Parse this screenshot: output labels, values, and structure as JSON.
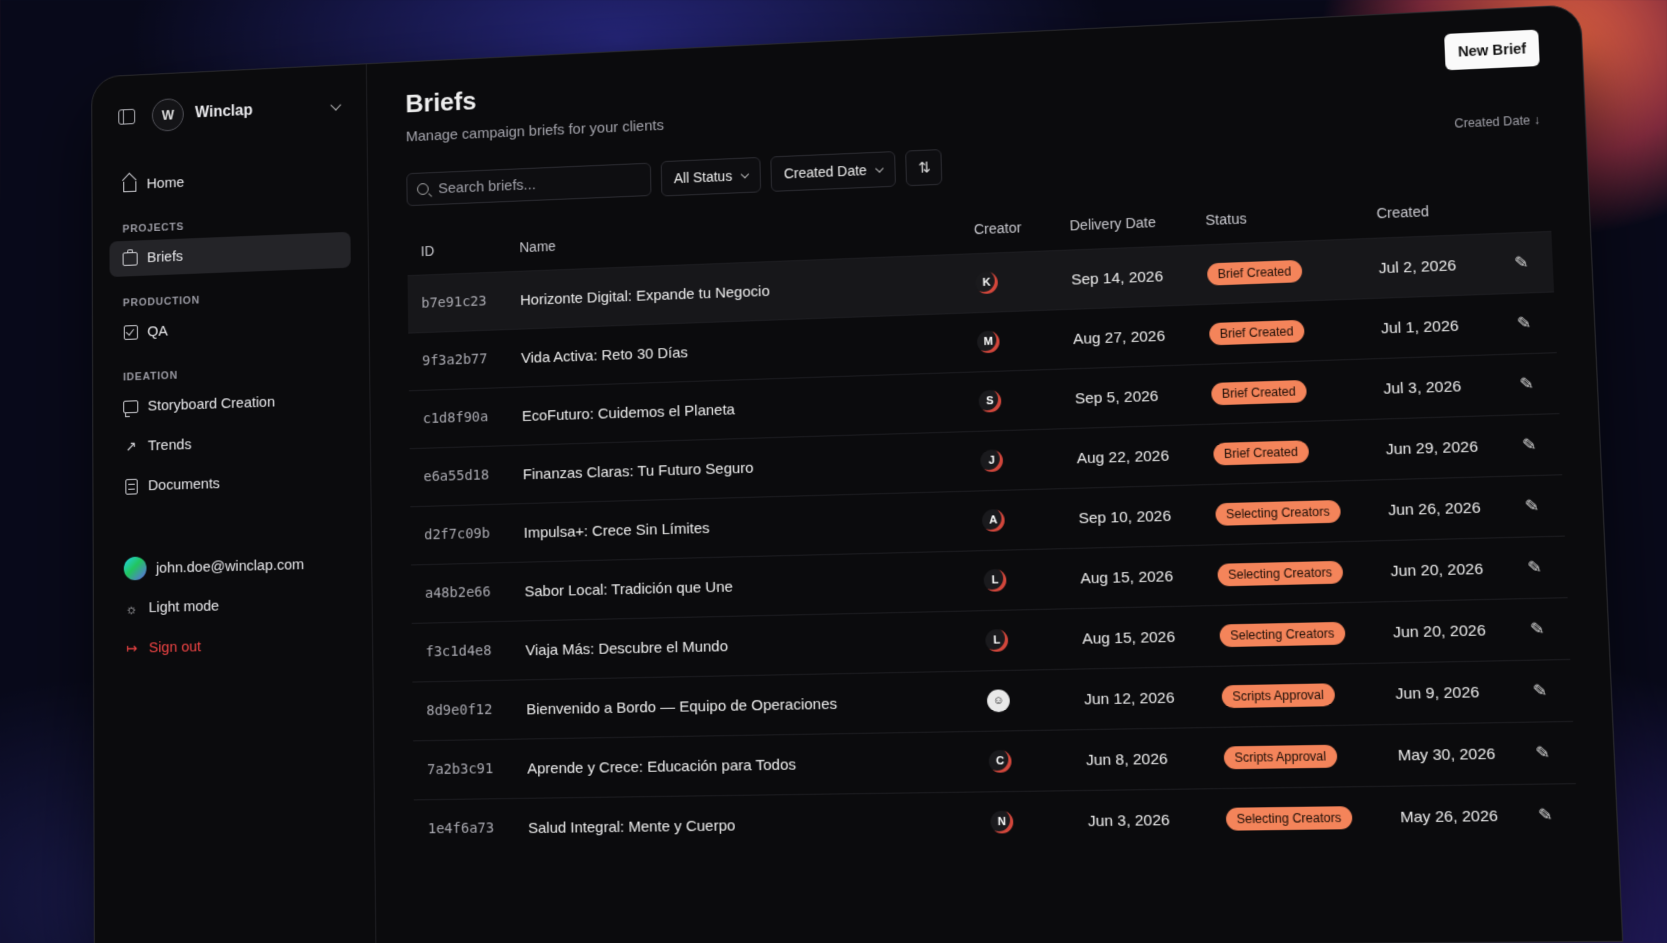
{
  "sidebar": {
    "workspace_name": "Winclap",
    "logo_text": "W",
    "home": "Home",
    "sections": {
      "projects": "PROJECTS",
      "production": "PRODUCTION",
      "ideation": "IDEATION"
    },
    "items": {
      "briefs": "Briefs",
      "qa": "QA",
      "storyboard": "Storyboard Creation",
      "trends": "Trends",
      "documents": "Documents"
    },
    "user_email": "john.doe@winclap.com",
    "light_mode": "Light mode",
    "sign_out": "Sign out"
  },
  "main": {
    "title": "Briefs",
    "subtitle": "Manage campaign briefs for your clients",
    "new_brief": "New Brief",
    "sort_hint": "Created Date ↓",
    "search_placeholder": "Search briefs...",
    "status_filter": "All Status",
    "date_filter": "Created Date",
    "sort_glyph": "⇅",
    "columns": [
      "ID",
      "Name",
      "Creator",
      "Delivery Date",
      "Status",
      "Created"
    ],
    "edit_glyph": "✎",
    "rows": [
      {
        "id": "b7e91c23",
        "name": "Horizonte Digital: Expande tu Negocio",
        "creator": "K",
        "delivery": "Sep 14, 2026",
        "status": "Brief Created",
        "created": "Jul 2, 2026"
      },
      {
        "id": "9f3a2b77",
        "name": "Vida Activa: Reto 30 Días",
        "creator": "M",
        "delivery": "Aug 27, 2026",
        "status": "Brief Created",
        "created": "Jul 1, 2026"
      },
      {
        "id": "c1d8f90a",
        "name": "EcoFuturo: Cuidemos el Planeta",
        "creator": "S",
        "delivery": "Sep 5, 2026",
        "status": "Brief Created",
        "created": "Jul 3, 2026"
      },
      {
        "id": "e6a55d18",
        "name": "Finanzas Claras: Tu Futuro Seguro",
        "creator": "J",
        "delivery": "Aug 22, 2026",
        "status": "Brief Created",
        "created": "Jun 29, 2026"
      },
      {
        "id": "d2f7c09b",
        "name": "Impulsa+: Crece Sin Límites",
        "creator": "A",
        "delivery": "Sep 10, 2026",
        "status": "Selecting Creators",
        "created": "Jun 26, 2026"
      },
      {
        "id": "a48b2e66",
        "name": "Sabor Local: Tradición que Une",
        "creator": "L",
        "delivery": "Aug 15, 2026",
        "status": "Selecting Creators",
        "created": "Jun 20, 2026"
      },
      {
        "id": "f3c1d4e8",
        "name": "Viaja Más: Descubre el Mundo",
        "creator": "L",
        "delivery": "Aug 15, 2026",
        "status": "Selecting Creators",
        "created": "Jun 20, 2026"
      },
      {
        "id": "8d9e0f12",
        "name": "Bienvenido a Bordo — Equipo de Operaciones",
        "creator": "",
        "delivery": "Jun 12, 2026",
        "status": "Scripts Approval",
        "created": "Jun 9, 2026"
      },
      {
        "id": "7a2b3c91",
        "name": "Aprende y Crece: Educación para Todos",
        "creator": "C",
        "delivery": "Jun 8, 2026",
        "status": "Scripts Approval",
        "created": "May 30, 2026"
      },
      {
        "id": "1e4f6a73",
        "name": "Salud Integral: Mente y Cuerpo",
        "creator": "N",
        "delivery": "Jun 3, 2026",
        "status": "Selecting Creators",
        "created": "May 26, 2026"
      }
    ]
  },
  "colors": {
    "badge": "#f4845a",
    "sign_out": "#ef4444",
    "background": "#0b0b0d"
  }
}
